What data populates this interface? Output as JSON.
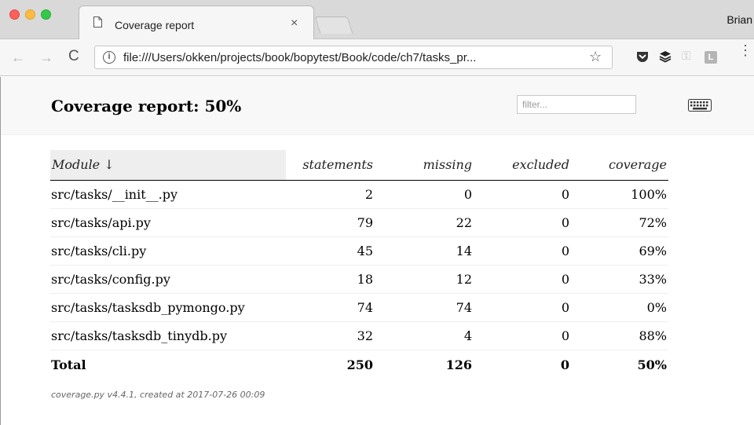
{
  "browser": {
    "tab_title": "Coverage report",
    "tab_close": "×",
    "profile_name": "Brian",
    "url": "file:///Users/okken/projects/book/bopytest/Book/code/ch7/tasks_pr...",
    "nav_back": "←",
    "nav_forward": "→",
    "nav_reload": "C",
    "info": "i",
    "star": "☆",
    "ext_l": "L",
    "menu": "⋮",
    "key": "⚿"
  },
  "report": {
    "title": "Coverage report: 50%",
    "filter_placeholder": "filter...",
    "columns": {
      "module": "Module ↓",
      "statements": "statements",
      "missing": "missing",
      "excluded": "excluded",
      "coverage": "coverage"
    },
    "rows": [
      {
        "module": "src/tasks/__init__.py",
        "statements": "2",
        "missing": "0",
        "excluded": "0",
        "coverage": "100%"
      },
      {
        "module": "src/tasks/api.py",
        "statements": "79",
        "missing": "22",
        "excluded": "0",
        "coverage": "72%"
      },
      {
        "module": "src/tasks/cli.py",
        "statements": "45",
        "missing": "14",
        "excluded": "0",
        "coverage": "69%"
      },
      {
        "module": "src/tasks/config.py",
        "statements": "18",
        "missing": "12",
        "excluded": "0",
        "coverage": "33%"
      },
      {
        "module": "src/tasks/tasksdb_pymongo.py",
        "statements": "74",
        "missing": "74",
        "excluded": "0",
        "coverage": "0%"
      },
      {
        "module": "src/tasks/tasksdb_tinydb.py",
        "statements": "32",
        "missing": "4",
        "excluded": "0",
        "coverage": "88%"
      }
    ],
    "total": {
      "module": "Total",
      "statements": "250",
      "missing": "126",
      "excluded": "0",
      "coverage": "50%"
    },
    "footer": "coverage.py v4.4.1, created at 2017-07-26 00:09"
  }
}
